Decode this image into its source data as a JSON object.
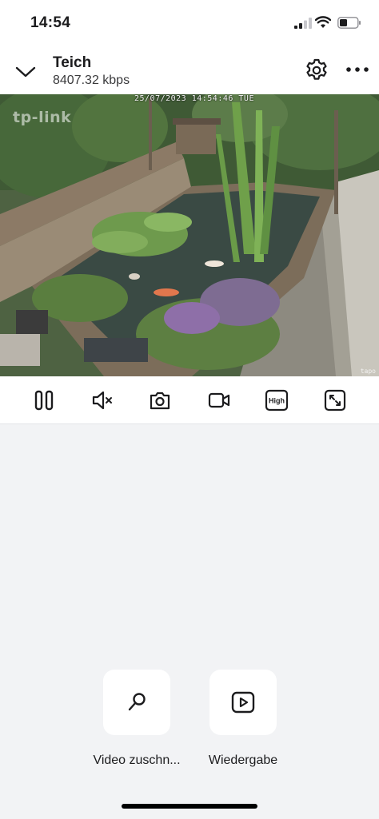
{
  "status_bar": {
    "time": "14:54",
    "icons": [
      "cellular-signal-icon",
      "wifi-icon",
      "battery-icon"
    ]
  },
  "header": {
    "back_icon": "chevron-down-icon",
    "title": "Teich",
    "bitrate": "8407.32 kbps",
    "settings_icon": "gear-icon",
    "more_icon": "ellipsis-icon"
  },
  "video": {
    "timestamp": "25/07/2023 14:54:46 TUE",
    "watermark": "tp-link",
    "brand_corner": "tapo"
  },
  "toolbar": {
    "icons": [
      "pause-icon",
      "speaker-muted-icon",
      "camera-snapshot-icon",
      "video-record-icon",
      "quality-badge-icon",
      "fullscreen-icon"
    ],
    "quality_label": "High"
  },
  "actions": [
    {
      "icon": "magnifier-icon",
      "label": "Video zuschn..."
    },
    {
      "icon": "play-icon",
      "label": "Wiedergabe"
    }
  ],
  "colors": {
    "background": "#f2f3f5",
    "surface": "#ffffff",
    "icon": "#1c1c1e"
  }
}
